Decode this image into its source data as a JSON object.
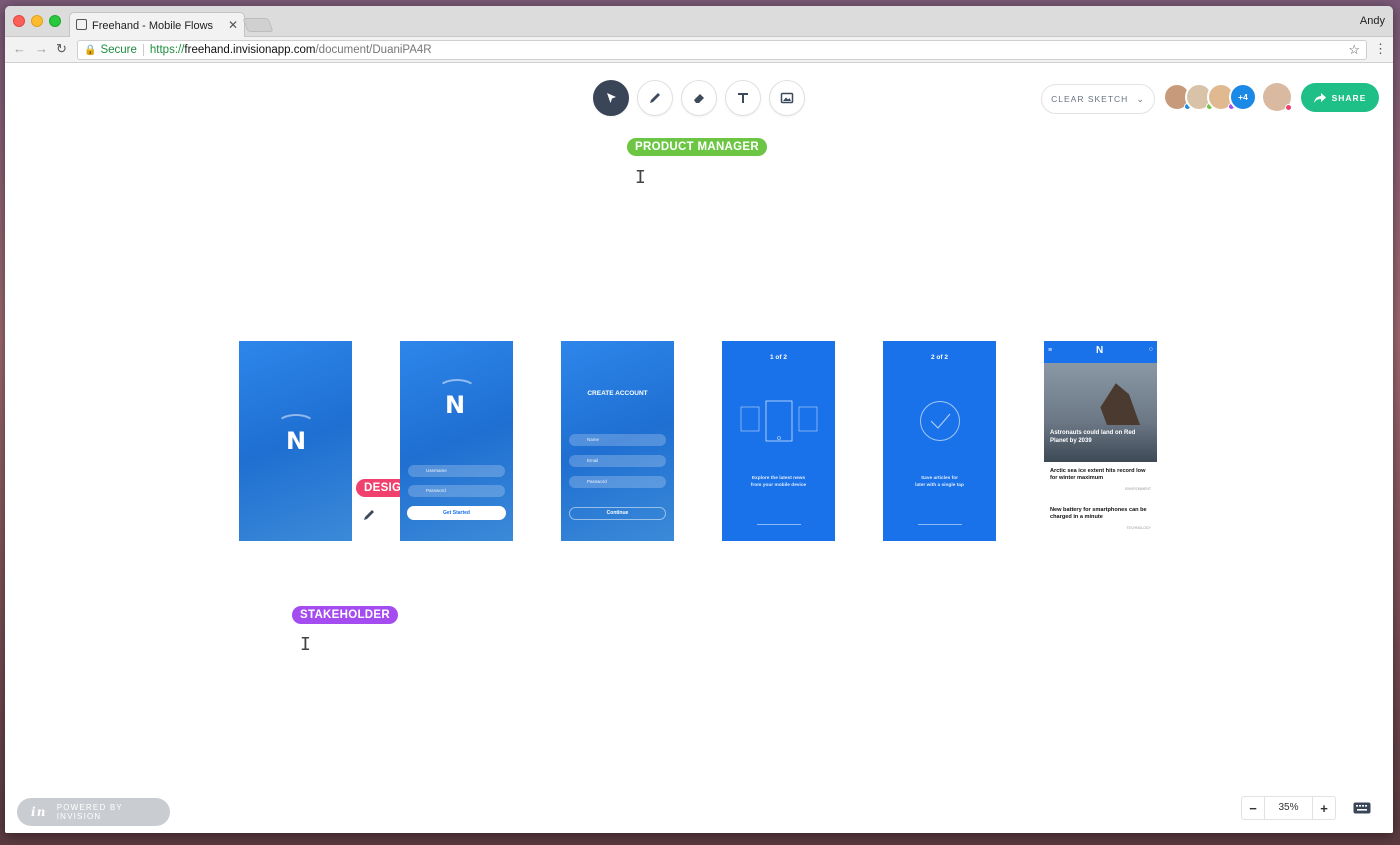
{
  "browser": {
    "tab_title": "Freehand - Mobile Flows",
    "user": "Andy",
    "secure_label": "Secure",
    "url_scheme": "https://",
    "url_host": "freehand.invisionapp.com",
    "url_path": "/document/DuaniPA4R"
  },
  "toolbar": {
    "tools": [
      "select",
      "pen",
      "eraser",
      "text",
      "image"
    ],
    "clear_sketch_label": "CLEAR SKETCH",
    "more_collaborators": "+4",
    "share_label": "SHARE"
  },
  "cursors": {
    "product_manager": "PRODUCT MANAGER",
    "designer": "DESIGNER",
    "stakeholder": "STAKEHOLDER"
  },
  "screens": {
    "login": {
      "username": "Username",
      "password": "Password",
      "cta": "Get Started"
    },
    "create_account": {
      "title": "CREATE ACCOUNT",
      "name": "Name",
      "email": "Email",
      "password": "Password",
      "cta": "Continue"
    },
    "onboarding1": {
      "step": "1 of 2",
      "caption_line1": "Explore the latest news",
      "caption_line2": "from your mobile device"
    },
    "onboarding2": {
      "step": "2 of 2",
      "caption_line1": "Save articles for",
      "caption_line2": "later with a single tap"
    },
    "news": {
      "hero_title": "Astronauts could land on Red Planet by 2039",
      "item1_title": "Arctic sea ice extent hits record low for winter maximum",
      "item1_tag": "ENVIRONMENT",
      "item2_title": "New battery for smartphones can be charged in a minute",
      "item2_tag": "TECHNOLOGY"
    }
  },
  "footer": {
    "powered_by": "POWERED BY INVISION",
    "zoom": "35%"
  },
  "colors": {
    "product_manager": "#6cc644",
    "designer": "#f0406e",
    "stakeholder": "#a44cf0",
    "share": "#1fc087",
    "screen_blue": "#1a72ea"
  }
}
